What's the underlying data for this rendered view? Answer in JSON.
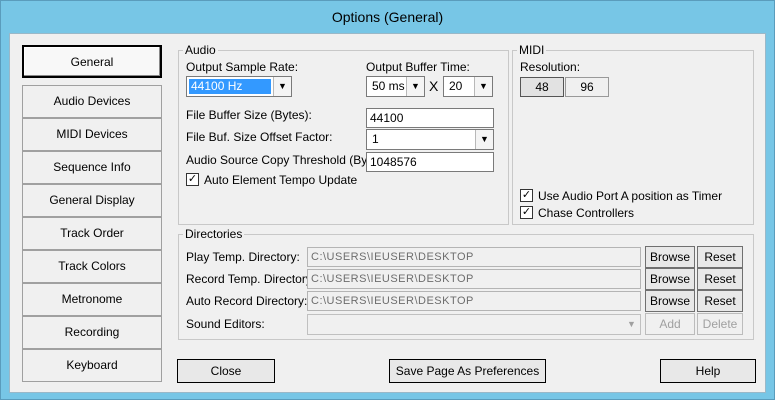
{
  "window": {
    "title": "Options (General)"
  },
  "tabs": [
    {
      "label": "General",
      "active": true
    },
    {
      "label": "Audio Devices"
    },
    {
      "label": "MIDI Devices"
    },
    {
      "label": "Sequence Info"
    },
    {
      "label": "General Display"
    },
    {
      "label": "Track Order"
    },
    {
      "label": "Track Colors"
    },
    {
      "label": "Metronome"
    },
    {
      "label": "Recording"
    },
    {
      "label": "Keyboard"
    }
  ],
  "audio": {
    "legend": "Audio",
    "output_sample_rate_label": "Output Sample Rate:",
    "output_sample_rate_value": "44100 Hz",
    "output_buffer_time_label": "Output Buffer Time:",
    "buffer_time_value": "50 ms",
    "buffer_multiplier_symbol": "X",
    "buffer_count_value": "20",
    "file_buffer_size_label": "File Buffer Size (Bytes):",
    "file_buffer_size_value": "44100",
    "file_buf_offset_label": "File Buf. Size Offset Factor:",
    "file_buf_offset_value": "1",
    "copy_threshold_label": "Audio Source Copy Threshold (Bytes):",
    "copy_threshold_value": "1048576",
    "auto_tempo_label": "Auto Element Tempo Update",
    "auto_tempo_checked": true
  },
  "midi": {
    "legend": "MIDI",
    "resolution_label": "Resolution:",
    "resolution_options": [
      "48",
      "96"
    ],
    "use_port_a_label": "Use Audio Port A position as Timer",
    "use_port_a_checked": true,
    "chase_controllers_label": "Chase Controllers",
    "chase_controllers_checked": true
  },
  "directories": {
    "legend": "Directories",
    "rows": [
      {
        "label": "Play Temp. Directory:",
        "path": "C:\\USERS\\IEUSER\\DESKTOP",
        "browse": "Browse",
        "reset": "Reset"
      },
      {
        "label": "Record Temp. Directory:",
        "path": "C:\\USERS\\IEUSER\\DESKTOP",
        "browse": "Browse",
        "reset": "Reset"
      },
      {
        "label": "Auto Record Directory:",
        "path": "C:\\USERS\\IEUSER\\DESKTOP",
        "browse": "Browse",
        "reset": "Reset"
      }
    ],
    "sound_editors_label": "Sound Editors:",
    "sound_editors_value": "",
    "add_label": "Add",
    "delete_label": "Delete"
  },
  "footer": {
    "close_label": "Close",
    "save_prefs_label": "Save Page As Preferences",
    "help_label": "Help"
  },
  "icons": {
    "dropdown": "chevron-down-icon",
    "check": "checkmark-icon"
  },
  "colors": {
    "titlebar": "#77c6e6",
    "selection": "#3399ff",
    "dialog_bg": "#f0f0f0"
  }
}
